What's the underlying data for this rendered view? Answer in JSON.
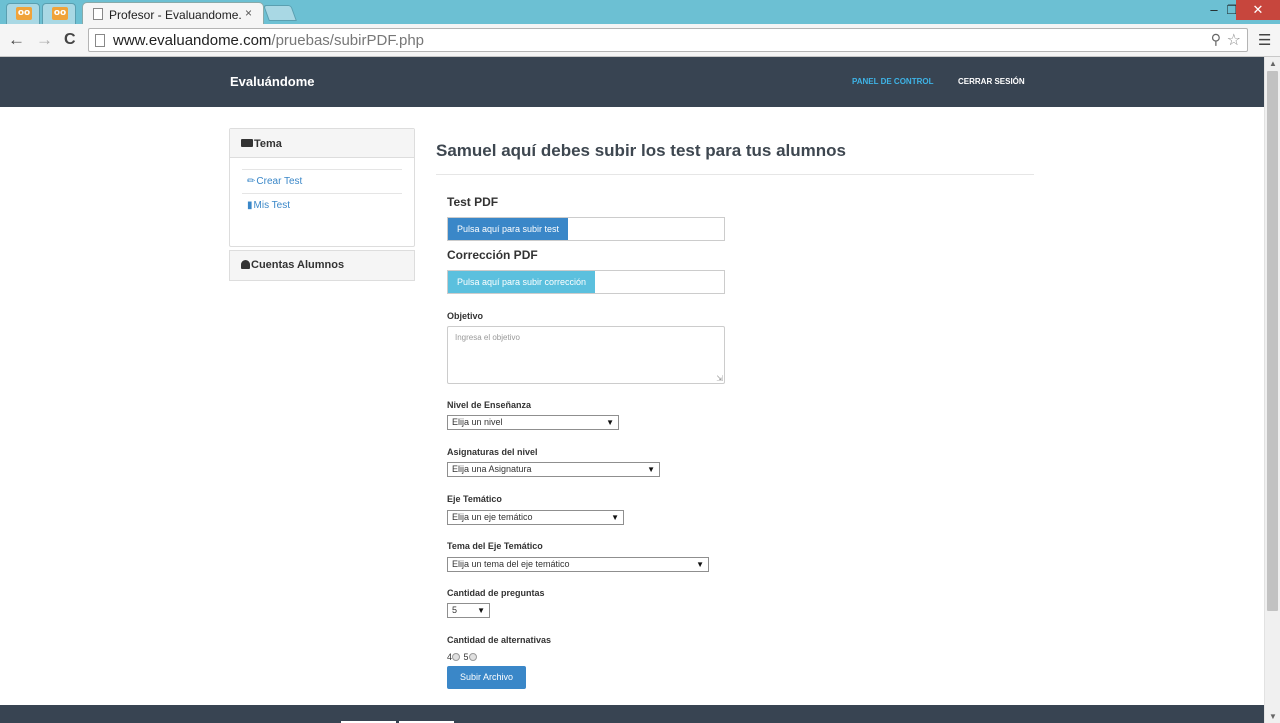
{
  "browser": {
    "tab_title": "Profesor - Evaluandome.c",
    "tab_close": "×",
    "small_tab_icon": "oo",
    "url_host": "www.evaluandome.com",
    "url_path": "/pruebas/subirPDF.php",
    "window_controls": {
      "minimize": "–",
      "maximize": "❐",
      "close": "✕"
    },
    "nav": {
      "back": "←",
      "forward": "→",
      "reload": "C"
    },
    "icons": {
      "zoom": "zoom-icon",
      "bookmark": "star-icon",
      "menu": "hamburger-menu-icon"
    }
  },
  "navbar": {
    "brand": "Evaluándome",
    "links": [
      "PANEL DE CONTROL",
      "CERRAR SESIÓN"
    ],
    "active_link_color": "#3eb3e6",
    "bg_color": "#384452"
  },
  "sidebar": {
    "tema_heading": "Tema",
    "items": [
      {
        "label": "Crear Test",
        "icon": "pencil-icon"
      },
      {
        "label": "Mis Test",
        "icon": "file-icon"
      }
    ],
    "accounts_heading": "Cuentas Alumnos"
  },
  "main": {
    "title": "Samuel aquí debes subir los test para tus alumnos",
    "test_pdf": {
      "label": "Test PDF",
      "button": "Pulsa aquí para subir test"
    },
    "correction_pdf": {
      "label": "Corrección PDF",
      "button": "Pulsa aquí para subir corrección"
    },
    "objective": {
      "label": "Objetivo",
      "placeholder": "Ingresa el objetivo"
    },
    "nivel": {
      "label": "Nivel de Enseñanza",
      "selected": "Elija un nivel"
    },
    "asignatura": {
      "label": "Asignaturas del nivel",
      "selected": "Elija una Asignatura"
    },
    "eje": {
      "label": "Eje Temático",
      "selected": "Elija un eje temático"
    },
    "tema_eje": {
      "label": "Tema del Eje Temático",
      "selected": "Elija un tema del eje temático"
    },
    "preguntas": {
      "label": "Cantidad de preguntas",
      "selected": "5"
    },
    "alternativas": {
      "label": "Cantidad de alternativas",
      "options": [
        "4",
        "5"
      ]
    },
    "submit": "Subir Archivo",
    "primary_color": "#3a87c8",
    "info_color": "#5bc0de"
  }
}
